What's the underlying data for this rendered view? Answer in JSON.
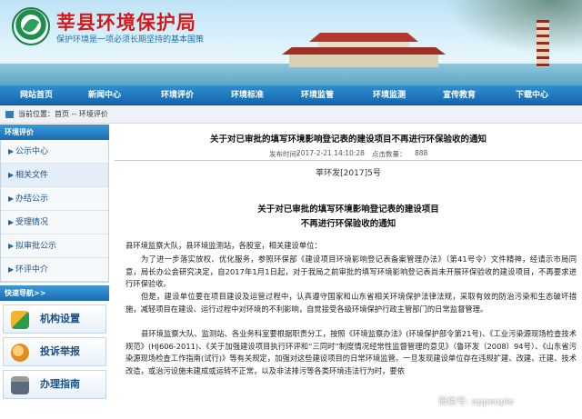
{
  "header": {
    "site_title": "莘县环境保护局",
    "slogan": "保护环境是一项必须长期坚持的基本国策"
  },
  "nav": {
    "items": [
      "网站首页",
      "新闻中心",
      "环境评价",
      "环境标准",
      "环境监管",
      "环境监测",
      "宣传教育",
      "下载中心"
    ]
  },
  "breadcrumb": {
    "text": "当前位置：首页 -- 环境评价"
  },
  "sidebar": {
    "title": "环境评价",
    "items": [
      {
        "label": "公示中心"
      },
      {
        "label": "相关文件"
      },
      {
        "label": "办结公示"
      },
      {
        "label": "受理情况"
      },
      {
        "label": "拟审批公示"
      },
      {
        "label": "环评中介"
      }
    ],
    "quick_title": "快速导航>>",
    "quick_items": [
      {
        "label": "机构设置",
        "icon": "org-structure-icon"
      },
      {
        "label": "投诉举报",
        "icon": "complaint-icon"
      },
      {
        "label": "办理指南",
        "icon": "guide-icon"
      }
    ]
  },
  "article": {
    "title": "关于对已审批的填写环境影响登记表的建设项目不再进行环保验收的通知",
    "date_label": "发布时间：",
    "date": "2017-2-21 14:10:28",
    "hits_label": "点击数量：",
    "hits": "888",
    "doc_number": "莘环发[2017]5号",
    "doc_heading_line1": "关于对已审批的填写环境影响登记表的建设项目",
    "doc_heading_line2": "不再进行环保验收的通知",
    "para1": "县环境监察大队，县环境监测站，各股室，相关建设单位：",
    "para2": "为了进一步落实放权、优化服务，参照环保部《建设项目环境影响登记表备案管理办法》（第41号令）文件精神，经请示市局同意，局长办公会研究决定，自2017年1月1日起，对于我局之前审批的填写环境影响登记表尚未开展环保验收的建设项目，不再要求进行环保验收。",
    "para3": "但是，建设单位要在项目建设及运营过程中，认真遵守国家和山东省相关环境保护法律法规，采取有效的防治污染和生态破坏措施，减轻项目在建设、运行过程中对环境的不利影响，自觉接受各级环境保护行政主管部门的日常监督管理。",
    "para4": "县环境监察大队、监测站、各业务科室要根据职责分工，按照《环境监察办法》(环境保护部令第21号)、《工业污染源现场检查技术规范》(HJ606-2011)、《关于加强建设项目执行环评和“三同时”制度情况经常性监督管理的意见》（鲁环发（2008）94号）、《山东省污染源现场检查工作指南(试行)》等有关规定，加强对这些建设项目的日常环境监管。一旦发现建设单位存在违规扩建、改建、迁建、技术改造，或治污设施未建成或运转不正常，以及非法排污等各类环境违法行为时，要依"
  },
  "watermark": {
    "text": "微信号: eppeople"
  },
  "colors": {
    "nav_blue": "#1466ac",
    "title_red": "#d4191d",
    "link_blue": "#1d4f84"
  }
}
